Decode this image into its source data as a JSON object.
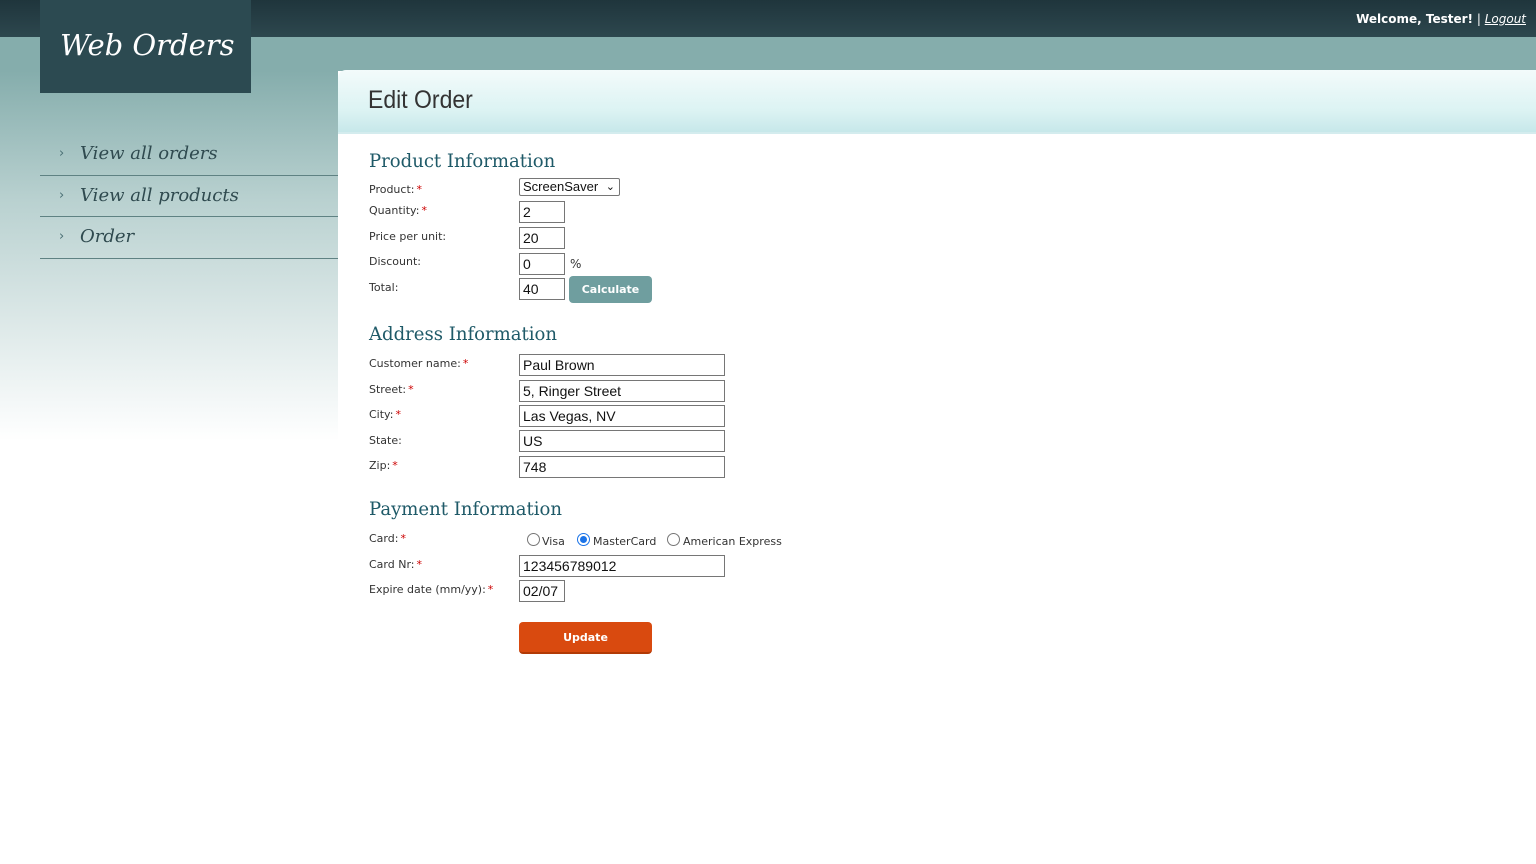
{
  "app": {
    "logo_text": "Web Orders"
  },
  "header": {
    "welcome": "Welcome, Tester!",
    "separator": "|",
    "logout": "Logout"
  },
  "nav": {
    "items": [
      {
        "label": "View all orders"
      },
      {
        "label": "View all products"
      },
      {
        "label": "Order"
      }
    ]
  },
  "page": {
    "title": "Edit Order"
  },
  "product": {
    "section_title": "Product Information",
    "product_label": "Product:",
    "product_value": "ScreenSaver",
    "quantity_label": "Quantity:",
    "quantity_value": "2",
    "price_label": "Price per unit:",
    "price_value": "20",
    "discount_label": "Discount:",
    "discount_value": "0",
    "discount_unit": "%",
    "total_label": "Total:",
    "total_value": "40",
    "calculate_label": "Calculate"
  },
  "address": {
    "section_title": "Address Information",
    "customer_label": "Customer name:",
    "customer_value": "Paul Brown",
    "street_label": "Street:",
    "street_value": "5, Ringer Street",
    "city_label": "City:",
    "city_value": "Las Vegas, NV",
    "state_label": "State:",
    "state_value": "US",
    "zip_label": "Zip:",
    "zip_value": "748"
  },
  "payment": {
    "section_title": "Payment Information",
    "card_label": "Card:",
    "card_options": [
      "Visa",
      "MasterCard",
      "American Express"
    ],
    "card_selected": "MasterCard",
    "card_nr_label": "Card Nr:",
    "card_nr_value": "123456789012",
    "expire_label": "Expire date (mm/yy):",
    "expire_value": "02/07",
    "update_label": "Update"
  },
  "required_marker": "*",
  "colors": {
    "topbar": "#1f353c",
    "teal": "#85adac",
    "logo_bg": "#2c4a51",
    "section_title": "#1f5a68",
    "calculate_btn": "#6f9e9f",
    "update_btn": "#d94a0f",
    "required": "#cc0000"
  },
  "icons": {
    "nav_arrow": "chevron-right-icon",
    "select_arrow": "chevron-down-icon"
  }
}
